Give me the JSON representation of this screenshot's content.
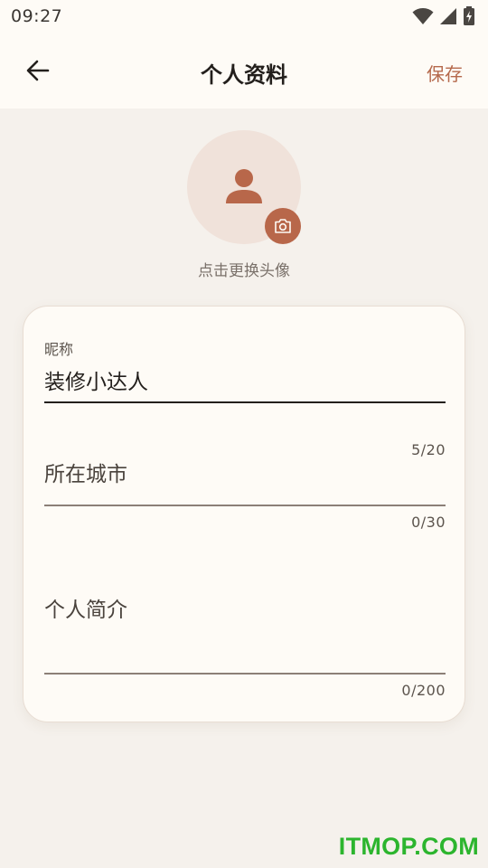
{
  "status_bar": {
    "time": "09:27"
  },
  "header": {
    "title": "个人资料",
    "save_label": "保存",
    "back_icon": "arrow-left-icon"
  },
  "avatar": {
    "hint": "点击更换头像",
    "icon": "person-icon",
    "badge_icon": "camera-icon"
  },
  "form": {
    "nickname": {
      "label": "昵称",
      "value": "装修小达人",
      "counter": "5/20"
    },
    "city": {
      "placeholder": "所在城市",
      "counter": "0/30"
    },
    "bio": {
      "placeholder": "个人简介",
      "counter": "0/200"
    }
  },
  "watermark": {
    "text": "ITMOP.COM"
  },
  "colors": {
    "accent": "#b8674a",
    "background": "#f5f1ec",
    "surface": "#fefbf6"
  }
}
